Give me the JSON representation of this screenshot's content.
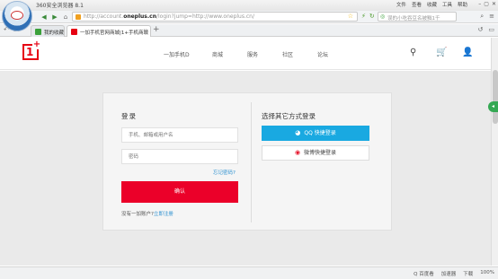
{
  "browser": {
    "title": "360安全浏览器 8.1",
    "menus": [
      "文件",
      "查看",
      "收藏",
      "工具",
      "帮助"
    ],
    "url_prefix": "http://account.",
    "url_domain": "oneplus.cn",
    "url_suffix": "/login?jump=http://www.oneplus.cn/",
    "search_placeholder": "误的小吃吞豆名被黜1千",
    "tabs": [
      {
        "label": "我的收藏"
      },
      {
        "label": "一加手机官网商城|1+手机商城"
      }
    ],
    "status": [
      "Q 百度看",
      "加速器",
      "下载",
      "100%"
    ]
  },
  "site": {
    "nav": [
      "一加手机D",
      "商城",
      "服务",
      "社区",
      "论坛"
    ]
  },
  "login": {
    "title": "登录",
    "account_placeholder": "手机、邮箱或用户名",
    "password_placeholder": "密码",
    "forgot": "忘记密码?",
    "button": "确认",
    "no_account": "没有一加账户?",
    "register": "立即注册"
  },
  "other": {
    "title": "选择其它方式登录",
    "qq": "QQ 快捷登录",
    "weibo": "微博快捷登录"
  },
  "colors": {
    "brand_red": "#eb0029",
    "qq_blue": "#19a9e1",
    "link_blue": "#2a8fcf"
  }
}
